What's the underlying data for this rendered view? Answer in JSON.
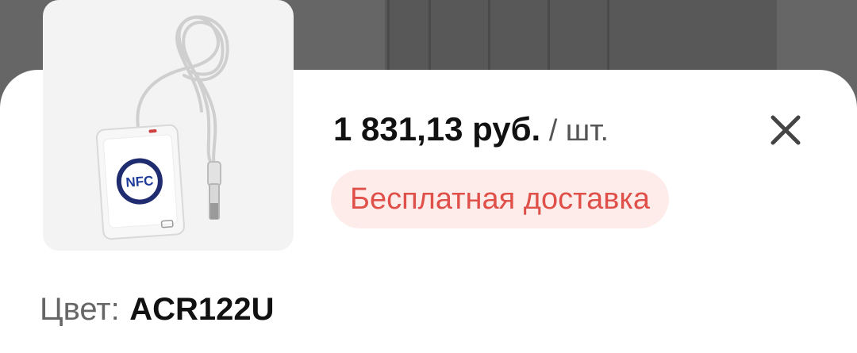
{
  "product": {
    "image_icon": "nfc-reader-image",
    "price": "1 831,13 руб.",
    "unit": "/ шт.",
    "nfc_logo_text": "NFC"
  },
  "badge": {
    "label": "Бесплатная доставка",
    "color": "#e0504a",
    "background": "#fdecea"
  },
  "option": {
    "label": "Цвет:",
    "value": "ACR122U"
  },
  "close_icon": "close-icon"
}
